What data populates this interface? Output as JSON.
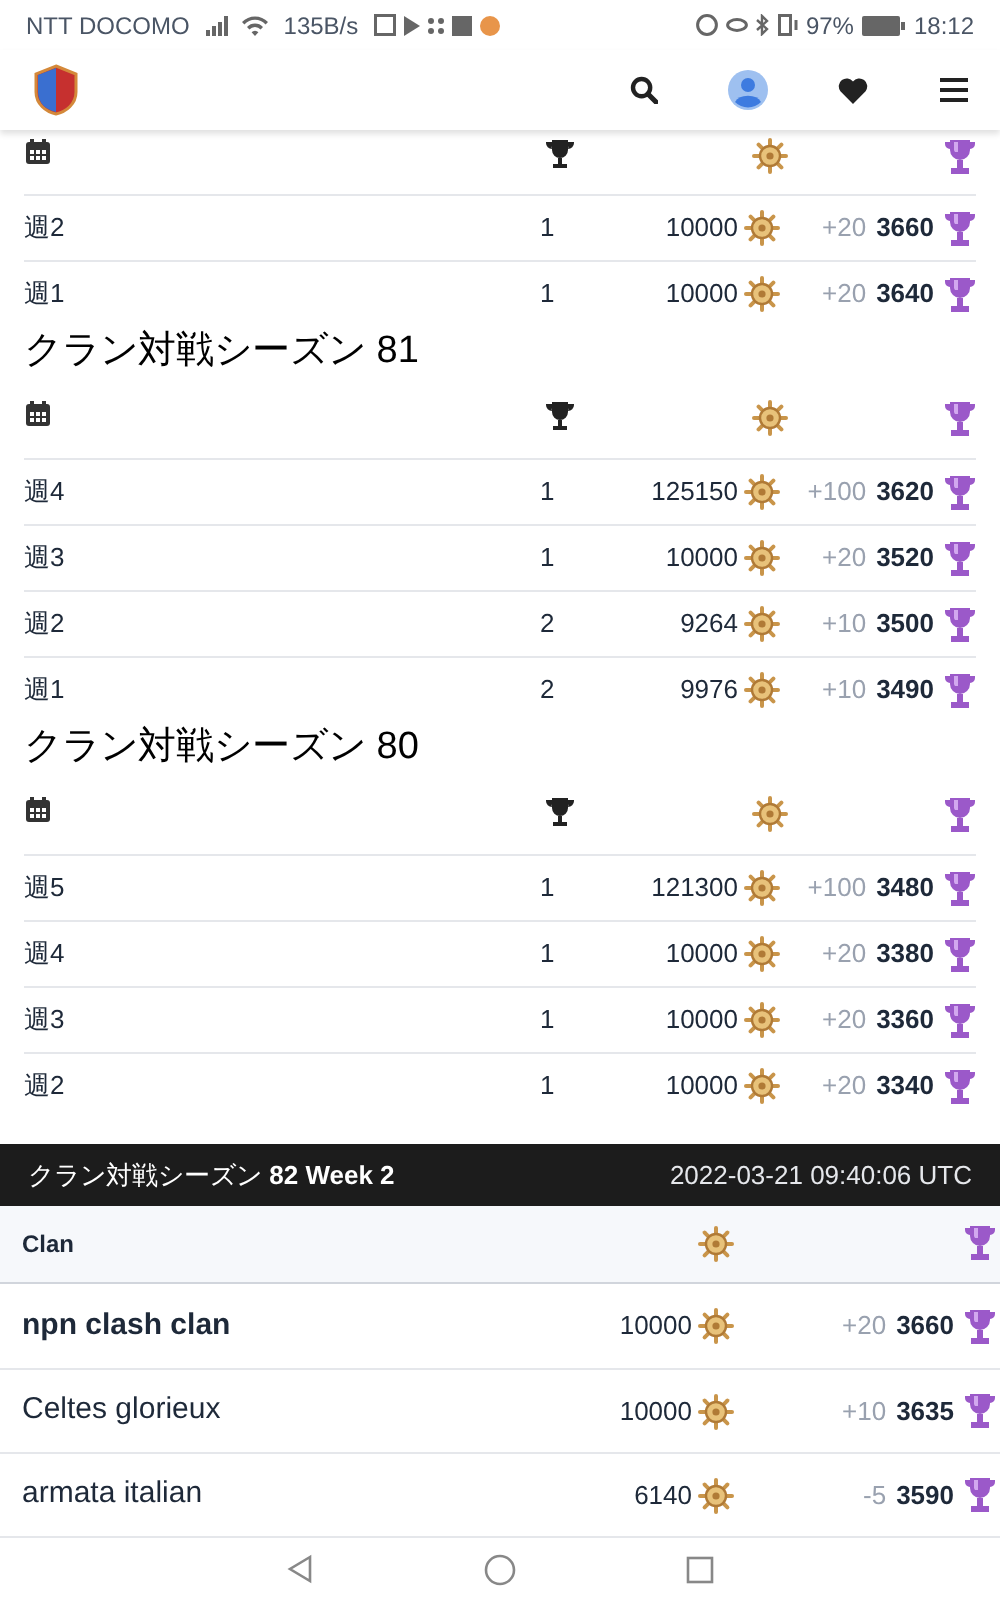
{
  "status_bar": {
    "carrier": "NTT DOCOMO",
    "speed": "135B/s",
    "battery": "97%",
    "time": "18:12"
  },
  "seasons": [
    {
      "weeks": [
        {
          "week": "週2",
          "rank": "1",
          "fame": "10000",
          "change": "+20",
          "trophies": "3660"
        },
        {
          "week": "週1",
          "rank": "1",
          "fame": "10000",
          "change": "+20",
          "trophies": "3640"
        }
      ]
    },
    {
      "title": "クラン対戦シーズン 81",
      "weeks": [
        {
          "week": "週4",
          "rank": "1",
          "fame": "125150",
          "change": "+100",
          "trophies": "3620"
        },
        {
          "week": "週3",
          "rank": "1",
          "fame": "10000",
          "change": "+20",
          "trophies": "3520"
        },
        {
          "week": "週2",
          "rank": "2",
          "fame": "9264",
          "change": "+10",
          "trophies": "3500"
        },
        {
          "week": "週1",
          "rank": "2",
          "fame": "9976",
          "change": "+10",
          "trophies": "3490"
        }
      ]
    },
    {
      "title": "クラン対戦シーズン 80",
      "weeks": [
        {
          "week": "週5",
          "rank": "1",
          "fame": "121300",
          "change": "+100",
          "trophies": "3480"
        },
        {
          "week": "週4",
          "rank": "1",
          "fame": "10000",
          "change": "+20",
          "trophies": "3380"
        },
        {
          "week": "週3",
          "rank": "1",
          "fame": "10000",
          "change": "+20",
          "trophies": "3360"
        },
        {
          "week": "週2",
          "rank": "1",
          "fame": "10000",
          "change": "+20",
          "trophies": "3340"
        }
      ]
    }
  ],
  "race": {
    "title": "クラン対戦シーズン **82 Week 2**",
    "time": "2022-03-21 09:40:06 UTC",
    "column_1": "Clan",
    "rows": [
      {
        "name": "npn clash clan",
        "own": true,
        "fame": "10000",
        "change": "+20",
        "trophies": "3660"
      },
      {
        "name": "Celtes glorieux",
        "own": false,
        "fame": "10000",
        "change": "+10",
        "trophies": "3635"
      },
      {
        "name": "armata italian",
        "own": false,
        "fame": "6140",
        "change": "-5",
        "trophies": "3590"
      }
    ]
  }
}
